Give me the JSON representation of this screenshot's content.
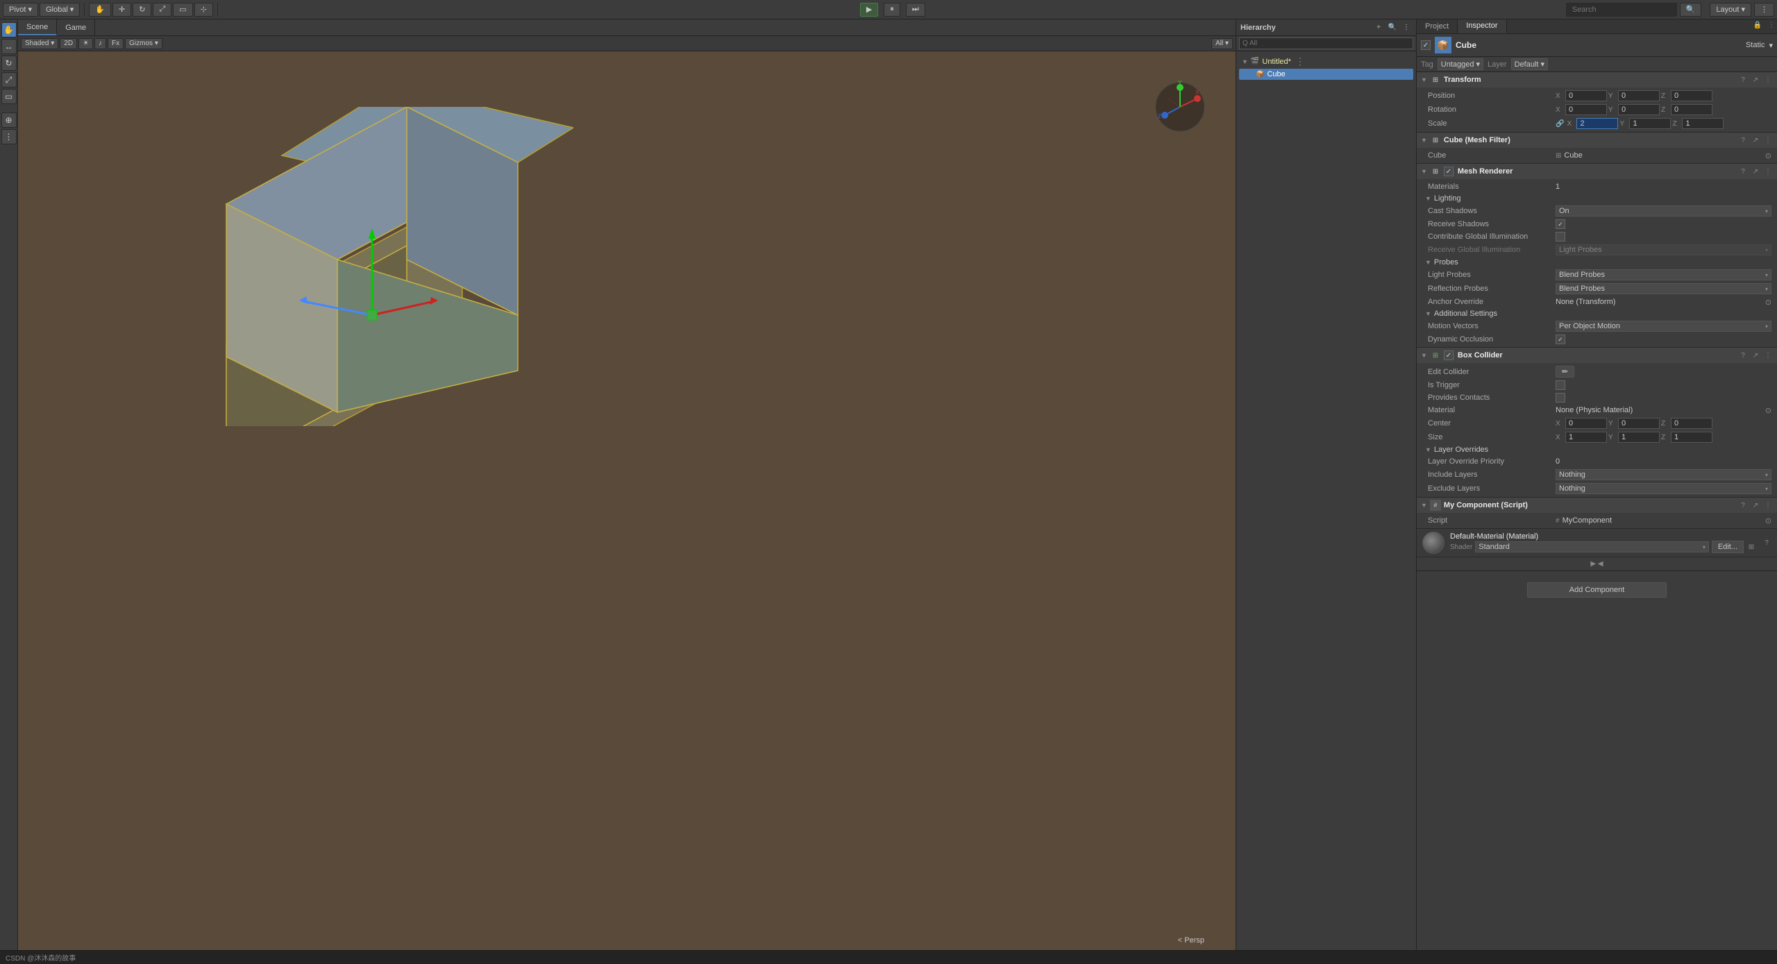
{
  "topToolbar": {
    "pivot_label": "Pivot",
    "global_label": "Global",
    "play_icon": "▶",
    "pause_icon": "⏸",
    "step_icon": "⏭",
    "scene_tab": "Scene",
    "game_tab": "Game",
    "all_label": "All",
    "search_placeholder": "Search",
    "layout_label": "Layout",
    "persp_label": "< Persp"
  },
  "sceneView": {
    "tabs": [
      "Scene",
      "Game"
    ],
    "toolbar": [
      "Shaded",
      "2D",
      "☀",
      "Fx",
      "Gizmos",
      "▼"
    ],
    "persp": "< Persp"
  },
  "hierarchy": {
    "title": "Hierarchy",
    "search_placeholder": "Q All",
    "add_icon": "+",
    "items": [
      {
        "name": "Untitled*",
        "level": 0,
        "modified": true,
        "arrow": "▼"
      },
      {
        "name": "Cube",
        "level": 1,
        "selected": true
      }
    ]
  },
  "inspector": {
    "title": "Inspector",
    "objectName": "Cube",
    "staticLabel": "Static",
    "tag": "Untagged",
    "layer": "Default",
    "components": {
      "transform": {
        "title": "Transform",
        "icon": "⊞",
        "position": {
          "label": "Position",
          "x": "0",
          "y": "0",
          "z": "0"
        },
        "rotation": {
          "label": "Rotation",
          "x": "0",
          "y": "0",
          "z": "0"
        },
        "scale": {
          "label": "Scale",
          "x": "2",
          "y": "1",
          "z": "1"
        }
      },
      "meshFilter": {
        "title": "Cube (Mesh Filter)",
        "icon": "⊞",
        "mesh": "Cube"
      },
      "meshRenderer": {
        "title": "Mesh Renderer",
        "icon": "⊞",
        "enabled": true,
        "materials": {
          "label": "Materials",
          "count": "1"
        },
        "lighting": {
          "title": "Lighting",
          "castShadows": {
            "label": "Cast Shadows",
            "value": "On"
          },
          "receiveShadows": {
            "label": "Receive Shadows",
            "checked": true
          },
          "contributeGI": {
            "label": "Contribute Global Illumination"
          },
          "receiveGI": {
            "label": "Receive Global Illumination",
            "value": "Light Probes"
          }
        },
        "probes": {
          "title": "Probes",
          "lightProbes": {
            "label": "Light Probes",
            "value": "Blend Probes"
          },
          "reflectionProbes": {
            "label": "Reflection Probes",
            "value": "Blend Probes"
          },
          "anchorOverride": {
            "label": "Anchor Override",
            "value": "None (Transform)"
          }
        },
        "additionalSettings": {
          "title": "Additional Settings",
          "motionVectors": {
            "label": "Motion Vectors",
            "value": "Per Object Motion"
          },
          "dynamicOcclusion": {
            "label": "Dynamic Occlusion",
            "checked": true
          }
        }
      },
      "boxCollider": {
        "title": "Box Collider",
        "icon": "⊞",
        "enabled": true,
        "editCollider": {
          "label": "Edit Collider"
        },
        "isTrigger": {
          "label": "Is Trigger"
        },
        "providesContacts": {
          "label": "Provides Contacts"
        },
        "material": {
          "label": "Material",
          "value": "None (Physic Material)"
        },
        "center": {
          "label": "Center",
          "x": "0",
          "y": "0",
          "z": "0"
        },
        "size": {
          "label": "Size",
          "x": "1",
          "y": "1",
          "z": "1"
        },
        "layerOverrides": {
          "title": "Layer Overrides",
          "priority": {
            "label": "Layer Override Priority",
            "value": "0"
          },
          "include": {
            "label": "Include Layers",
            "value": "Nothing"
          },
          "exclude": {
            "label": "Exclude Layers",
            "value": "Nothing"
          }
        }
      },
      "myComponent": {
        "title": "My Component (Script)",
        "icon": "#",
        "script": {
          "label": "Script",
          "value": "MyComponent"
        }
      },
      "material": {
        "name": "Default-Material (Material)",
        "shader": {
          "label": "Shader",
          "value": "Standard"
        },
        "editBtn": "Edit...",
        "icon": "⊞"
      }
    },
    "addComponentBtn": "Add Component"
  },
  "bottomBar": {
    "csdn_text": "CSDN @沐沐森的故事"
  }
}
